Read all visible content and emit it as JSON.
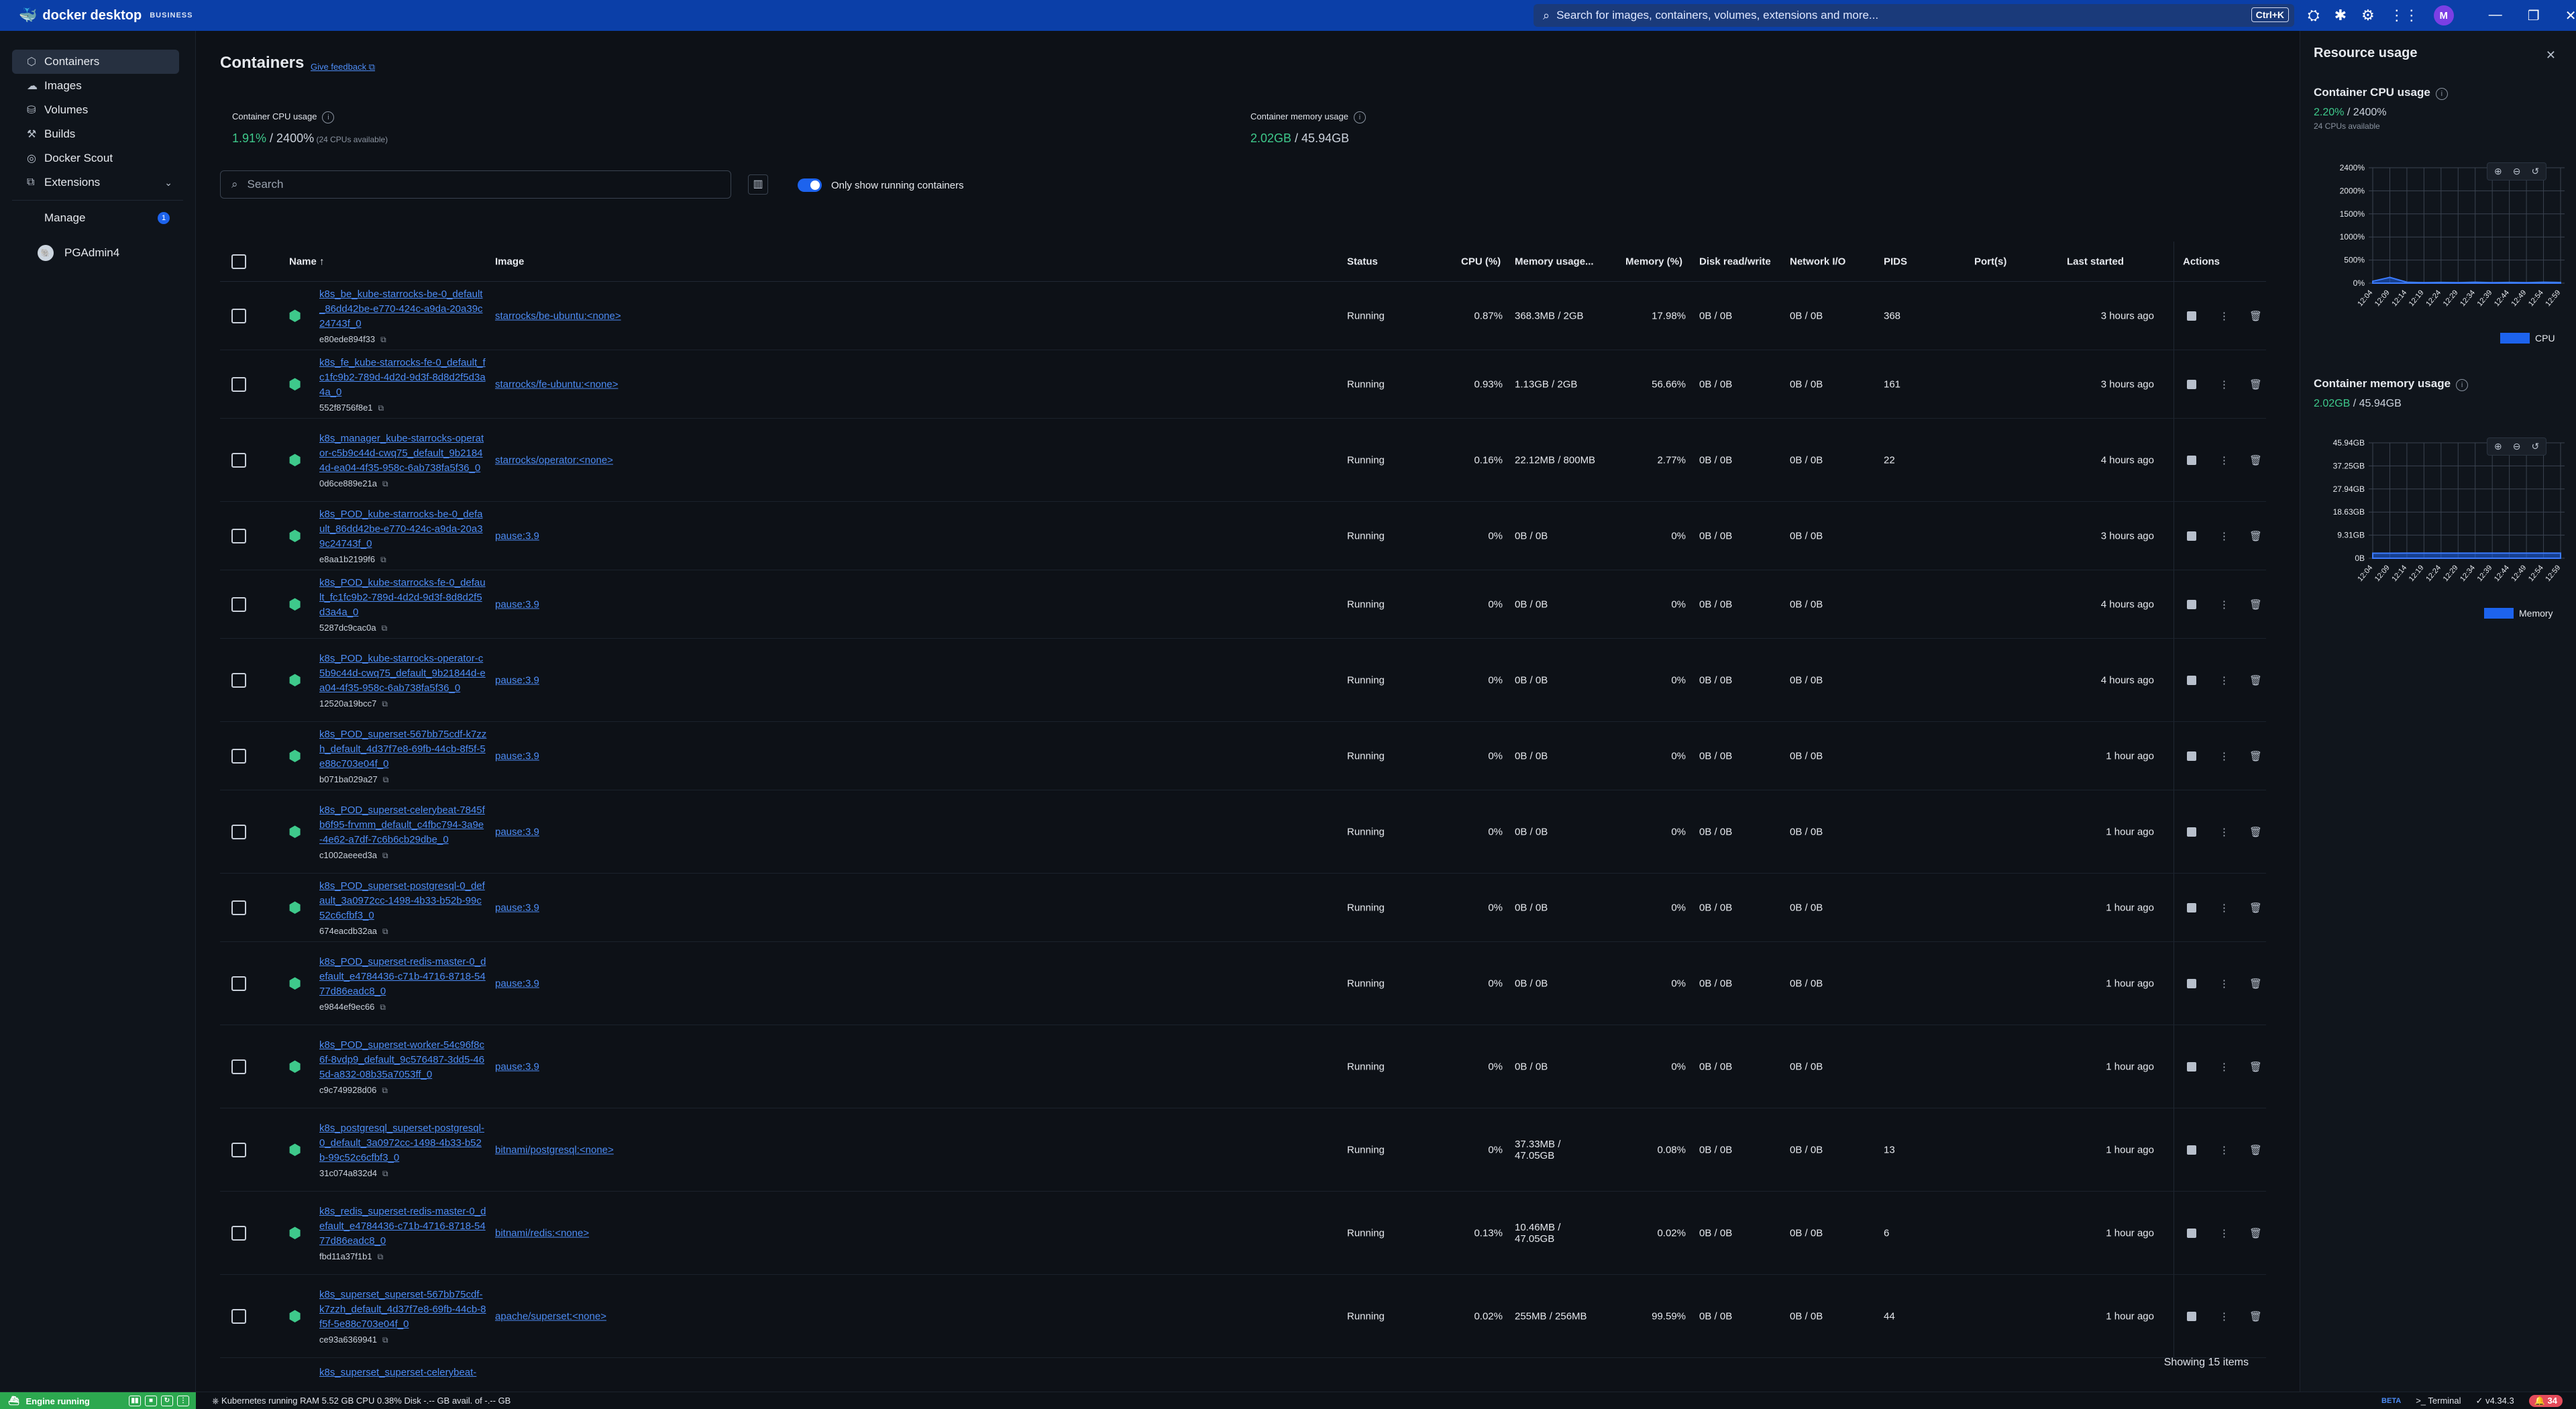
{
  "titlebar": {
    "brand": "docker desktop",
    "badge": "BUSINESS",
    "search_placeholder": "Search for images, containers, volumes, extensions and more...",
    "shortcut": "Ctrl+K",
    "avatar_letter": "M"
  },
  "sidebar": {
    "items": [
      {
        "label": "Containers",
        "icon": "container-icon"
      },
      {
        "label": "Images",
        "icon": "image-icon"
      },
      {
        "label": "Volumes",
        "icon": "volume-icon"
      },
      {
        "label": "Builds",
        "icon": "build-icon"
      },
      {
        "label": "Docker Scout",
        "icon": "scout-icon"
      },
      {
        "label": "Extensions",
        "icon": "extensions-icon"
      }
    ],
    "manage_label": "Manage",
    "manage_count": "1",
    "extension_name": "PGAdmin4"
  },
  "main": {
    "title": "Containers",
    "feedback": "Give feedback",
    "cpu_label": "Container CPU usage",
    "cpu_value": "1.91%",
    "cpu_total": " / 2400%",
    "cpu_sub": " (24 CPUs available)",
    "mem_label": "Container memory usage",
    "mem_value": "2.02GB",
    "mem_total": " / 45.94GB",
    "search_placeholder": "Search",
    "toggle_label": "Only show running containers",
    "showing": "Showing 15 items"
  },
  "table": {
    "headers": {
      "name": "Name",
      "image": "Image",
      "status": "Status",
      "cpu": "CPU (%)",
      "mem_usage": "Memory usage...",
      "mem_pct": "Memory (%)",
      "disk": "Disk read/write",
      "net": "Network I/O",
      "pids": "PIDS",
      "ports": "Port(s)",
      "started": "Last started",
      "actions": "Actions"
    },
    "rows": [
      {
        "name": "k8s_be_kube-starrocks-be-0_default_86dd42be-e770-424c-a9da-20a39c24743f_0",
        "id": "e80ede894f33",
        "image": "starrocks/be-ubuntu:<none>",
        "status": "Running",
        "cpu": "0.87%",
        "mem": "368.3MB / 2GB",
        "mem_pct": "17.98%",
        "disk": "0B / 0B",
        "net": "0B / 0B",
        "pids": "368",
        "started": "3 hours ago"
      },
      {
        "name": "k8s_fe_kube-starrocks-fe-0_default_fc1fc9b2-789d-4d2d-9d3f-8d8d2f5d3a4a_0",
        "id": "552f8756f8e1",
        "image": "starrocks/fe-ubuntu:<none>",
        "status": "Running",
        "cpu": "0.93%",
        "mem": "1.13GB / 2GB",
        "mem_pct": "56.66%",
        "disk": "0B / 0B",
        "net": "0B / 0B",
        "pids": "161",
        "started": "3 hours ago"
      },
      {
        "name": "k8s_manager_kube-starrocks-operator-c5b9c44d-cwq75_default_9b21844d-ea04-4f35-958c-6ab738fa5f36_0",
        "id": "0d6ce889e21a",
        "image": "starrocks/operator:<none>",
        "status": "Running",
        "cpu": "0.16%",
        "mem": "22.12MB / 800MB",
        "mem_pct": "2.77%",
        "disk": "0B / 0B",
        "net": "0B / 0B",
        "pids": "22",
        "started": "4 hours ago"
      },
      {
        "name": "k8s_POD_kube-starrocks-be-0_default_86dd42be-e770-424c-a9da-20a39c24743f_0",
        "id": "e8aa1b2199f6",
        "image": "pause:3.9",
        "status": "Running",
        "cpu": "0%",
        "mem": "0B / 0B",
        "mem_pct": "0%",
        "disk": "0B / 0B",
        "net": "0B / 0B",
        "pids": "",
        "started": "3 hours ago"
      },
      {
        "name": "k8s_POD_kube-starrocks-fe-0_default_fc1fc9b2-789d-4d2d-9d3f-8d8d2f5d3a4a_0",
        "id": "5287dc9cac0a",
        "image": "pause:3.9",
        "status": "Running",
        "cpu": "0%",
        "mem": "0B / 0B",
        "mem_pct": "0%",
        "disk": "0B / 0B",
        "net": "0B / 0B",
        "pids": "",
        "started": "4 hours ago"
      },
      {
        "name": "k8s_POD_kube-starrocks-operator-c5b9c44d-cwq75_default_9b21844d-ea04-4f35-958c-6ab738fa5f36_0",
        "id": "12520a19bcc7",
        "image": "pause:3.9",
        "status": "Running",
        "cpu": "0%",
        "mem": "0B / 0B",
        "mem_pct": "0%",
        "disk": "0B / 0B",
        "net": "0B / 0B",
        "pids": "",
        "started": "4 hours ago"
      },
      {
        "name": "k8s_POD_superset-567bb75cdf-k7zzh_default_4d37f7e8-69fb-44cb-8f5f-5e88c703e04f_0",
        "id": "b071ba029a27",
        "image": "pause:3.9",
        "status": "Running",
        "cpu": "0%",
        "mem": "0B / 0B",
        "mem_pct": "0%",
        "disk": "0B / 0B",
        "net": "0B / 0B",
        "pids": "",
        "started": "1 hour ago"
      },
      {
        "name": "k8s_POD_superset-celerybeat-7845fb6f95-frvmm_default_c4fbc794-3a9e-4e62-a7df-7c6b6cb29dbe_0",
        "id": "c1002aeeed3a",
        "image": "pause:3.9",
        "status": "Running",
        "cpu": "0%",
        "mem": "0B / 0B",
        "mem_pct": "0%",
        "disk": "0B / 0B",
        "net": "0B / 0B",
        "pids": "",
        "started": "1 hour ago"
      },
      {
        "name": "k8s_POD_superset-postgresql-0_default_3a0972cc-1498-4b33-b52b-99c52c6cfbf3_0",
        "id": "674eacdb32aa",
        "image": "pause:3.9",
        "status": "Running",
        "cpu": "0%",
        "mem": "0B / 0B",
        "mem_pct": "0%",
        "disk": "0B / 0B",
        "net": "0B / 0B",
        "pids": "",
        "started": "1 hour ago"
      },
      {
        "name": "k8s_POD_superset-redis-master-0_default_e4784436-c71b-4716-8718-5477d86eadc8_0",
        "id": "e9844ef9ec66",
        "image": "pause:3.9",
        "status": "Running",
        "cpu": "0%",
        "mem": "0B / 0B",
        "mem_pct": "0%",
        "disk": "0B / 0B",
        "net": "0B / 0B",
        "pids": "",
        "started": "1 hour ago"
      },
      {
        "name": "k8s_POD_superset-worker-54c96f8c6f-8vdp9_default_9c576487-3dd5-465d-a832-08b35a7053ff_0",
        "id": "c9c749928d06",
        "image": "pause:3.9",
        "status": "Running",
        "cpu": "0%",
        "mem": "0B / 0B",
        "mem_pct": "0%",
        "disk": "0B / 0B",
        "net": "0B / 0B",
        "pids": "",
        "started": "1 hour ago"
      },
      {
        "name": "k8s_postgresql_superset-postgresql-0_default_3a0972cc-1498-4b33-b52b-99c52c6cfbf3_0",
        "id": "31c074a832d4",
        "image": "bitnami/postgresql:<none>",
        "status": "Running",
        "cpu": "0%",
        "mem": "37.33MB / 47.05GB",
        "mem_pct": "0.08%",
        "disk": "0B / 0B",
        "net": "0B / 0B",
        "pids": "13",
        "started": "1 hour ago"
      },
      {
        "name": "k8s_redis_superset-redis-master-0_default_e4784436-c71b-4716-8718-5477d86eadc8_0",
        "id": "fbd11a37f1b1",
        "image": "bitnami/redis:<none>",
        "status": "Running",
        "cpu": "0.13%",
        "mem": "10.46MB / 47.05GB",
        "mem_pct": "0.02%",
        "disk": "0B / 0B",
        "net": "0B / 0B",
        "pids": "6",
        "started": "1 hour ago"
      },
      {
        "name": "k8s_superset_superset-567bb75cdf-k7zzh_default_4d37f7e8-69fb-44cb-8f5f-5e88c703e04f_0",
        "id": "ce93a6369941",
        "image": "apache/superset:<none>",
        "status": "Running",
        "cpu": "0.02%",
        "mem": "255MB / 256MB",
        "mem_pct": "99.59%",
        "disk": "0B / 0B",
        "net": "0B / 0B",
        "pids": "44",
        "started": "1 hour ago"
      }
    ],
    "partial_row_name": "k8s_superset_superset-celerybeat-"
  },
  "resource_panel": {
    "title": "Resource usage",
    "cpu_title": "Container CPU usage",
    "cpu_value": "2.20%",
    "cpu_total": " / 2400%",
    "cpu_sub": "24 CPUs available",
    "mem_title": "Container memory usage",
    "mem_value": "2.02GB",
    "mem_total": " / 45.94GB",
    "cpu_legend": "CPU",
    "mem_legend": "Memory"
  },
  "chart_data": [
    {
      "type": "area",
      "title": "Container CPU usage",
      "x": [
        "12:04",
        "12:09",
        "12:14",
        "12:19",
        "12:24",
        "12:29",
        "12:34",
        "12:39",
        "12:44",
        "12:49",
        "12:54",
        "12:59"
      ],
      "ytick_labels": [
        "0%",
        "500%",
        "1000%",
        "1500%",
        "2000%",
        "2400%"
      ],
      "ylim": [
        0,
        2400
      ],
      "series": [
        {
          "name": "CPU",
          "values": [
            40,
            120,
            20,
            10,
            15,
            10,
            20,
            10,
            15,
            10,
            20,
            15
          ]
        }
      ],
      "legend": "bottom-right",
      "grid": true
    },
    {
      "type": "area",
      "title": "Container memory usage",
      "x": [
        "12:04",
        "12:09",
        "12:14",
        "12:19",
        "12:24",
        "12:29",
        "12:34",
        "12:39",
        "12:44",
        "12:49",
        "12:54",
        "12:59"
      ],
      "ytick_labels": [
        "0B",
        "9.31GB",
        "18.63GB",
        "27.94GB",
        "37.25GB",
        "45.94GB"
      ],
      "ylim": [
        0,
        45.94
      ],
      "series": [
        {
          "name": "Memory",
          "values": [
            2.0,
            2.01,
            2.02,
            2.02,
            2.02,
            2.02,
            2.02,
            2.02,
            2.02,
            2.02,
            2.02,
            2.02
          ]
        }
      ],
      "legend": "bottom-right",
      "grid": true
    }
  ],
  "footer": {
    "engine": "Engine running",
    "status": "Kubernetes running  RAM 5.52 GB  CPU 0.38%    Disk -.-- GB avail. of -.-- GB",
    "beta": "BETA",
    "terminal": "Terminal",
    "version": "v4.34.3",
    "notifications": "34"
  },
  "colors": {
    "accent": "#1d63ed",
    "running_green": "#3ec98b",
    "titlebar": "#0b3fa8"
  }
}
